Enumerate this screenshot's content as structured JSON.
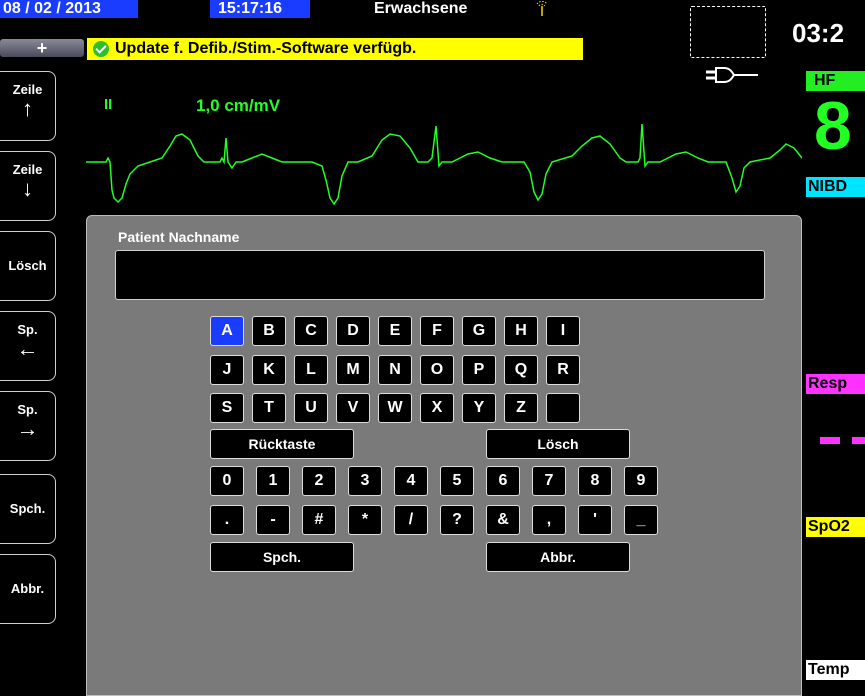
{
  "status_bar": {
    "date": "08 / 02 / 2013",
    "time": "15:17:16",
    "mode": "Erwachsene",
    "clock": "03:2",
    "plus_label": "+",
    "update_message": "Update f. Defib./Stim.-Software verfügb."
  },
  "softkeys": [
    {
      "label": "Zeile",
      "arrow": "↑"
    },
    {
      "label": "Zeile",
      "arrow": "↓"
    },
    {
      "label": "Lösch",
      "arrow": ""
    },
    {
      "label": "Sp.",
      "arrow": "←"
    },
    {
      "label": "Sp.",
      "arrow": "→"
    },
    {
      "label": "Spch.",
      "arrow": ""
    },
    {
      "label": "Abbr.",
      "arrow": ""
    }
  ],
  "ecg": {
    "lead": "II",
    "scale": "1,0 cm/mV",
    "color": "#22ff22"
  },
  "params": {
    "hf_label": "HF",
    "hf_value": "8",
    "nibd_label": "NIBD",
    "resp_label": "Resp",
    "spo2_label": "SpO2",
    "temp_label": "Temp"
  },
  "entry": {
    "field_label": "Patient Nachname",
    "value": "",
    "selected_key": "A"
  },
  "keyboard": {
    "rows": [
      [
        "A",
        "B",
        "C",
        "D",
        "E",
        "F",
        "G",
        "H",
        "I"
      ],
      [
        "J",
        "K",
        "L",
        "M",
        "N",
        "O",
        "P",
        "Q",
        "R"
      ],
      [
        "S",
        "T",
        "U",
        "V",
        "W",
        "X",
        "Y",
        "Z",
        ""
      ]
    ],
    "backspace_label": "Rücktaste",
    "clear_label": "Lösch",
    "number_rows": [
      [
        "0",
        "1",
        "2",
        "3",
        "4",
        "5",
        "6",
        "7",
        "8",
        "9"
      ],
      [
        ".",
        "-",
        "#",
        "*",
        "/",
        "?",
        "&",
        ",",
        "'",
        "_"
      ]
    ],
    "save_label": "Spch.",
    "cancel_label": "Abbr."
  },
  "colors": {
    "accent_blue": "#1a3cff",
    "hf_green": "#22ee22",
    "nibd_cyan": "#00e5ff",
    "resp_magenta": "#ff33ff",
    "spo2_yellow": "#ffff00",
    "panel_gray": "#7a7a7a"
  }
}
